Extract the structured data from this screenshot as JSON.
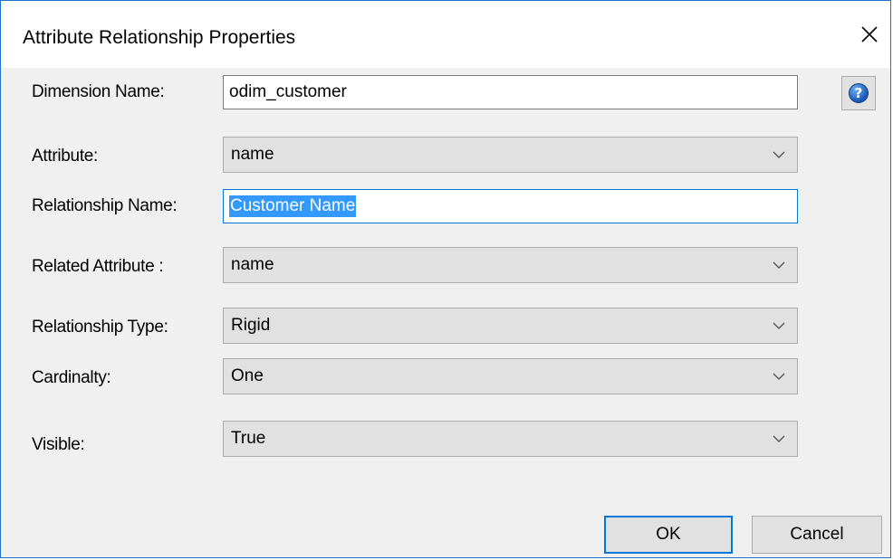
{
  "window": {
    "title": "Attribute Relationship Properties"
  },
  "fields": {
    "dimension_name": {
      "label": "Dimension Name:",
      "value": "odim_customer"
    },
    "attribute": {
      "label": "Attribute:",
      "value": "name"
    },
    "relationship_name": {
      "label": "Relationship Name:",
      "value": "Customer Name"
    },
    "related_attribute": {
      "label": "Related Attribute :",
      "value": "name"
    },
    "relationship_type": {
      "label": "Relationship Type:",
      "value": "Rigid"
    },
    "cardinality": {
      "label": "Cardinalty:",
      "value": "One"
    },
    "visible": {
      "label": "Visible:",
      "value": "True"
    }
  },
  "buttons": {
    "ok": "OK",
    "cancel": "Cancel",
    "help_glyph": "?"
  },
  "icons": {
    "close": "close-icon",
    "help": "help-icon",
    "dropdown": "chevron-down-icon"
  },
  "colors": {
    "accent": "#0078d7",
    "selection": "#3399ff",
    "dialog_bg": "#f0f0f0",
    "control_bg": "#e1e1e1"
  }
}
